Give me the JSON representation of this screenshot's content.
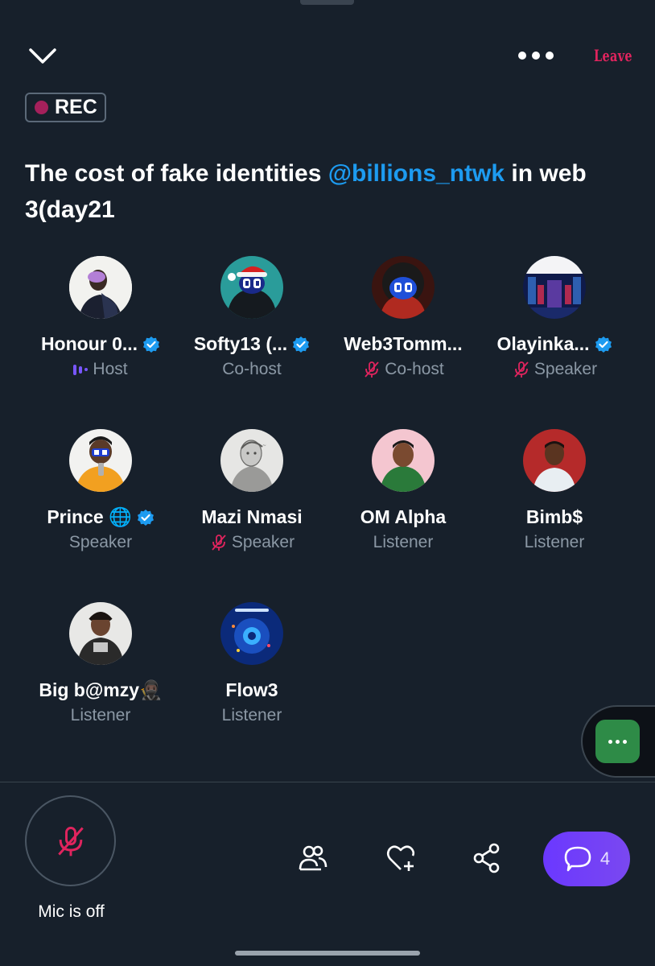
{
  "header": {
    "leave_label": "Leave",
    "rec_label": "REC"
  },
  "space": {
    "title_prefix": "The cost of fake identities ",
    "title_mention": "@billions_ntwk",
    "title_suffix": " in web 3(day21"
  },
  "participants": [
    {
      "name": "Honour 0...",
      "role": "Host",
      "verified": true
    },
    {
      "name": "Softy13 (...",
      "role": "Co-host",
      "verified": true
    },
    {
      "name": "Web3Tomm...",
      "role": "Co-host",
      "verified": false,
      "muted": true
    },
    {
      "name": "Olayinka...",
      "role": "Speaker",
      "verified": true,
      "muted": true
    },
    {
      "name": "Prince 🌐",
      "role": "Speaker",
      "verified": true
    },
    {
      "name": "Mazi Nmasi",
      "role": "Speaker",
      "verified": false,
      "muted": true
    },
    {
      "name": "OM Alpha",
      "role": "Listener",
      "verified": false
    },
    {
      "name": "Bimb$",
      "role": "Listener",
      "verified": false
    },
    {
      "name": "Big b@mzy🥷🏿",
      "role": "Listener",
      "verified": false
    },
    {
      "name": "Flow3",
      "role": "Listener",
      "verified": false
    }
  ],
  "bottom_bar": {
    "mic_label": "Mic is off",
    "chat_count": "4"
  },
  "colors": {
    "background": "#17202b",
    "accent": "#1d9bf0",
    "leave": "#e0245e",
    "host_purple": "#7856ff",
    "muted_pink": "#e0245e"
  }
}
